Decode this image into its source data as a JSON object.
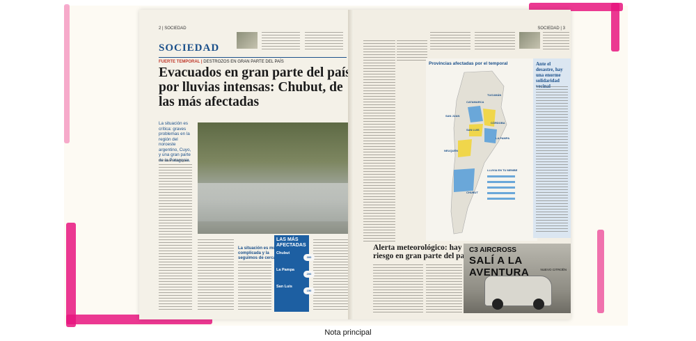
{
  "caption": "Nota principal",
  "left_page": {
    "folio": "2 | SOCIEDAD",
    "section": "SOCIEDAD",
    "kicker_label": "FUERTE TEMPORAL |",
    "kicker_text": "DESTROZOS EN GRAN PARTE DEL PAÍS",
    "headline": "Evacuados en gran parte del país por lluvias intensas: Chubut, de las más afectadas",
    "lead": "La situación es crítica: graves problemas en la región del noroeste argentino, Cuyo, y una gran parte de la Patagonia.",
    "byline": "Por Martín Rodríguez",
    "pull_quote": "La situación es muy complicada y la seguimos de cerca",
    "infobox": {
      "title": "LAS MÁS AFECTADAS",
      "items": [
        {
          "province": "Chubut",
          "pill": "300"
        },
        {
          "province": "La Pampa",
          "pill": "200"
        },
        {
          "province": "San Luis",
          "pill": "150"
        }
      ]
    }
  },
  "right_page": {
    "folio": "SOCIEDAD | 3",
    "map_title": "Provincias afectadas por el temporal",
    "map_labels": [
      "CATAMARCA",
      "TUCUMÁN",
      "SAN JUAN",
      "CÓRDOBA",
      "SAN LUIS",
      "LA PAMPA",
      "NEUQUÉN",
      "CHUBUT"
    ],
    "legend_title": "LLUVIA EN TU MEMBE",
    "sidebar_heading": "Ante el desastre, hay una enorme solidaridad vecinal",
    "alert_headline": "Alerta meteorológico: hay riesgo en gran parte del país",
    "ad": {
      "brand": "C3 AIRCROSS",
      "slogan": "SALÍ A LA AVENTURA",
      "model": "NUEVO CITROËN"
    }
  },
  "colors": {
    "accent": "#1a4f8a",
    "frame": "#e8157f",
    "box": "#1d5fa2"
  }
}
